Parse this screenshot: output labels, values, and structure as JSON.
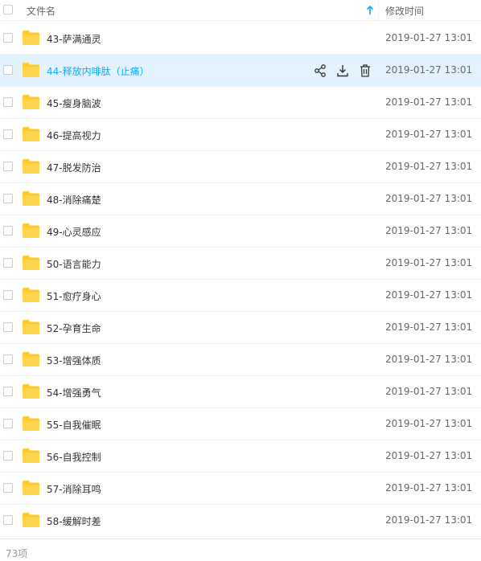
{
  "header": {
    "name_label": "文件名",
    "time_label": "修改时间",
    "sort_icon": "arrow-up-icon"
  },
  "colors": {
    "folder": "#ffca28",
    "accent": "#09aaff",
    "hover_bg": "#e3f3fd"
  },
  "files": [
    {
      "name": "43-萨满通灵",
      "time": "2019-01-27 13:01"
    },
    {
      "name": "44-释放内啡肽（止痛）",
      "time": "2019-01-27 13:01",
      "hovered": true
    },
    {
      "name": "45-瘦身脑波",
      "time": "2019-01-27 13:01"
    },
    {
      "name": "46-提高视力",
      "time": "2019-01-27 13:01"
    },
    {
      "name": "47-脱发防治",
      "time": "2019-01-27 13:01"
    },
    {
      "name": "48-消除痛楚",
      "time": "2019-01-27 13:01"
    },
    {
      "name": "49-心灵感应",
      "time": "2019-01-27 13:01"
    },
    {
      "name": "50-语言能力",
      "time": "2019-01-27 13:01"
    },
    {
      "name": "51-愈疗身心",
      "time": "2019-01-27 13:01"
    },
    {
      "name": "52-孕育生命",
      "time": "2019-01-27 13:01"
    },
    {
      "name": "53-增强体质",
      "time": "2019-01-27 13:01"
    },
    {
      "name": "54-增强勇气",
      "time": "2019-01-27 13:01"
    },
    {
      "name": "55-自我催眠",
      "time": "2019-01-27 13:01"
    },
    {
      "name": "56-自我控制",
      "time": "2019-01-27 13:01"
    },
    {
      "name": "57-消除耳鸣",
      "time": "2019-01-27 13:01"
    },
    {
      "name": "58-缓解时差",
      "time": "2019-01-27 13:01"
    }
  ],
  "row_actions": [
    "share-icon",
    "download-icon",
    "delete-icon"
  ],
  "footer": {
    "count": "73项"
  }
}
